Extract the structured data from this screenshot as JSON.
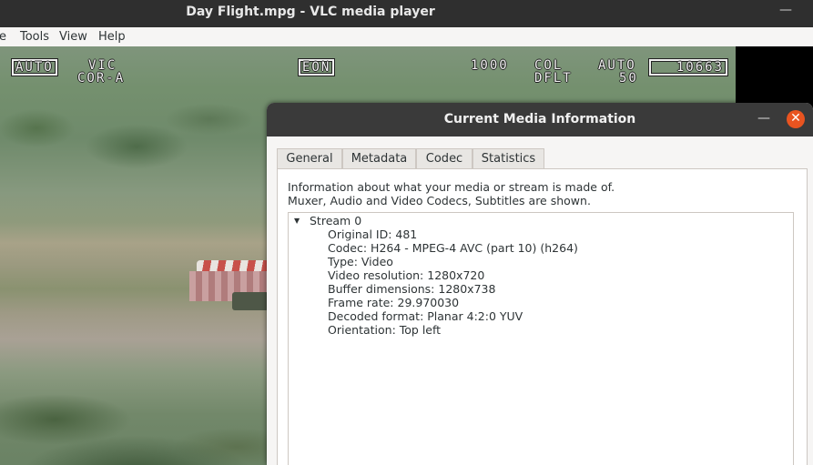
{
  "window": {
    "title": "Day Flight.mpg - VLC media player",
    "minimize_glyph": "—"
  },
  "menubar": {
    "items": [
      {
        "label": "e"
      },
      {
        "label": "Tools"
      },
      {
        "label": "View"
      },
      {
        "label": "Help"
      }
    ]
  },
  "hud": {
    "auto_left": "AUTO",
    "vic": "VIC",
    "cor": "COR-A",
    "eon": "EON",
    "num_1000": "1000",
    "col": "COL",
    "dflt": "DFLT",
    "auto_right": "AUTO",
    "num_50": "50",
    "counter": "10663"
  },
  "dialog": {
    "title": "Current Media Information",
    "minimize_glyph": "—",
    "close_glyph": "✕",
    "tabs": [
      {
        "label": "General",
        "active": false
      },
      {
        "label": "Metadata",
        "active": false
      },
      {
        "label": "Codec",
        "active": true
      },
      {
        "label": "Statistics",
        "active": false
      }
    ],
    "info_line1": "Information about what your media or stream is made of.",
    "info_line2": "Muxer, Audio and Video Codecs, Subtitles are shown.",
    "tree": {
      "stream_label": "Stream 0",
      "expander_icon": "triangle-down-icon",
      "rows": [
        "Original ID: 481",
        "Codec: H264 - MPEG-4 AVC (part 10) (h264)",
        "Type: Video",
        "Video resolution: 1280x720",
        "Buffer dimensions: 1280x738",
        "Frame rate: 29.970030",
        "Decoded format: Planar 4:2:0 YUV",
        "Orientation: Top left"
      ]
    }
  },
  "colors": {
    "close_button": "#e95420",
    "titlebar": "#2f2f2f",
    "dialog_header": "#3a3a3a"
  }
}
